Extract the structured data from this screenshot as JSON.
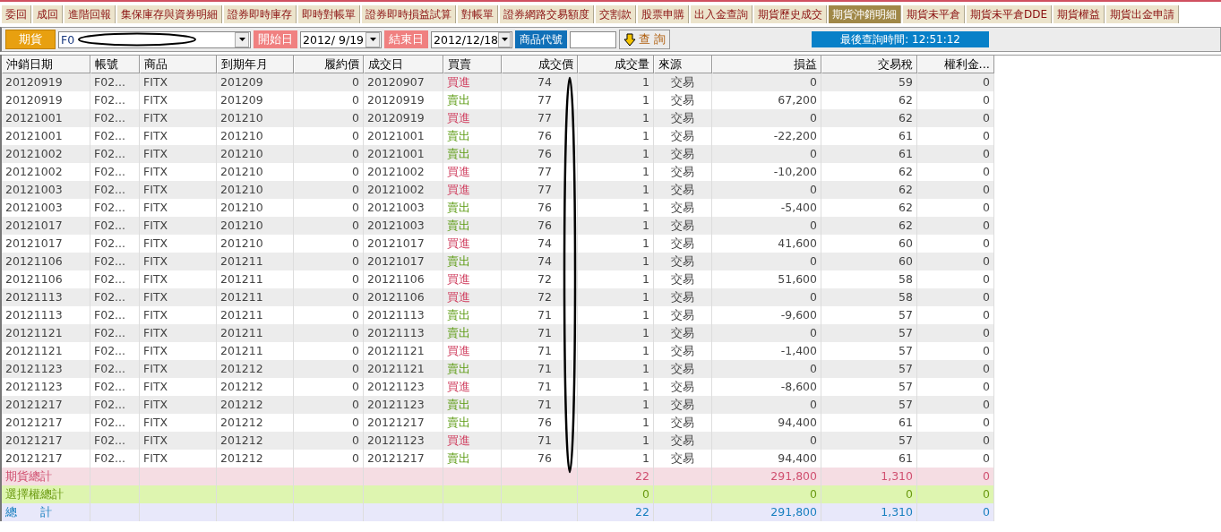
{
  "tabs": [
    {
      "label": "委回",
      "selected": false
    },
    {
      "label": "成回",
      "selected": false
    },
    {
      "label": "進階回報",
      "selected": false
    },
    {
      "label": "集保庫存與資券明細",
      "selected": false
    },
    {
      "label": "證券即時庫存",
      "selected": false
    },
    {
      "label": "即時對帳單",
      "selected": false
    },
    {
      "label": "證券即時損益試算",
      "selected": false
    },
    {
      "label": "對帳單",
      "selected": false
    },
    {
      "label": "證券網路交易額度",
      "selected": false
    },
    {
      "label": "交割款",
      "selected": false
    },
    {
      "label": "股票申購",
      "selected": false
    },
    {
      "label": "出入金查詢",
      "selected": false
    },
    {
      "label": "期貨歷史成交",
      "selected": false
    },
    {
      "label": "期貨沖銷明細",
      "selected": true
    },
    {
      "label": "期貨未平倉",
      "selected": false
    },
    {
      "label": "期貨未平倉DDE",
      "selected": false
    },
    {
      "label": "期貨權益",
      "selected": false
    },
    {
      "label": "期貨出金申請",
      "selected": false
    }
  ],
  "toolbar": {
    "market_label": "期貨",
    "account": "F0",
    "start_label": "開始日",
    "start_date": "2012/ 9/19",
    "end_label": "結束日",
    "end_date": "2012/12/18",
    "product_label": "商品代號",
    "query_button": "查 詢",
    "last_query": "最後查詢時間: 12:51:12"
  },
  "table": {
    "columns": [
      "沖銷日期",
      "帳號",
      "商品",
      "到期年月",
      "履約價",
      "成交日",
      "買賣",
      "成交價",
      "成交量",
      "來源",
      "損益",
      "交易稅",
      "權利金..."
    ],
    "rows": [
      {
        "kind": "buy",
        "cells": [
          "20120919",
          "F02...",
          "FITX",
          "201209",
          "0",
          "20120907",
          "買進",
          "74",
          "1",
          "交易",
          "0",
          "59",
          "0"
        ]
      },
      {
        "kind": "sell",
        "cells": [
          "20120919",
          "F02...",
          "FITX",
          "201209",
          "0",
          "20120919",
          "賣出",
          "77",
          "1",
          "交易",
          "67,200",
          "62",
          "0"
        ]
      },
      {
        "kind": "buy",
        "cells": [
          "20121001",
          "F02...",
          "FITX",
          "201210",
          "0",
          "20120919",
          "買進",
          "77",
          "1",
          "交易",
          "0",
          "62",
          "0"
        ]
      },
      {
        "kind": "sell",
        "cells": [
          "20121001",
          "F02...",
          "FITX",
          "201210",
          "0",
          "20121001",
          "賣出",
          "76",
          "1",
          "交易",
          "-22,200",
          "61",
          "0"
        ]
      },
      {
        "kind": "sell",
        "cells": [
          "20121002",
          "F02...",
          "FITX",
          "201210",
          "0",
          "20121001",
          "賣出",
          "76",
          "1",
          "交易",
          "0",
          "61",
          "0"
        ]
      },
      {
        "kind": "buy",
        "cells": [
          "20121002",
          "F02...",
          "FITX",
          "201210",
          "0",
          "20121002",
          "買進",
          "77",
          "1",
          "交易",
          "-10,200",
          "62",
          "0"
        ]
      },
      {
        "kind": "buy",
        "cells": [
          "20121003",
          "F02...",
          "FITX",
          "201210",
          "0",
          "20121002",
          "買進",
          "77",
          "1",
          "交易",
          "0",
          "62",
          "0"
        ]
      },
      {
        "kind": "sell",
        "cells": [
          "20121003",
          "F02...",
          "FITX",
          "201210",
          "0",
          "20121003",
          "賣出",
          "76",
          "1",
          "交易",
          "-5,400",
          "62",
          "0"
        ]
      },
      {
        "kind": "sell",
        "cells": [
          "20121017",
          "F02...",
          "FITX",
          "201210",
          "0",
          "20121003",
          "賣出",
          "76",
          "1",
          "交易",
          "0",
          "62",
          "0"
        ]
      },
      {
        "kind": "buy",
        "cells": [
          "20121017",
          "F02...",
          "FITX",
          "201210",
          "0",
          "20121017",
          "買進",
          "74",
          "1",
          "交易",
          "41,600",
          "60",
          "0"
        ]
      },
      {
        "kind": "sell",
        "cells": [
          "20121106",
          "F02...",
          "FITX",
          "201211",
          "0",
          "20121017",
          "賣出",
          "74",
          "1",
          "交易",
          "0",
          "60",
          "0"
        ]
      },
      {
        "kind": "buy",
        "cells": [
          "20121106",
          "F02...",
          "FITX",
          "201211",
          "0",
          "20121106",
          "買進",
          "72",
          "1",
          "交易",
          "51,600",
          "58",
          "0"
        ]
      },
      {
        "kind": "buy",
        "cells": [
          "20121113",
          "F02...",
          "FITX",
          "201211",
          "0",
          "20121106",
          "買進",
          "72",
          "1",
          "交易",
          "0",
          "58",
          "0"
        ]
      },
      {
        "kind": "sell",
        "cells": [
          "20121113",
          "F02...",
          "FITX",
          "201211",
          "0",
          "20121113",
          "賣出",
          "71",
          "1",
          "交易",
          "-9,600",
          "57",
          "0"
        ]
      },
      {
        "kind": "sell",
        "cells": [
          "20121121",
          "F02...",
          "FITX",
          "201211",
          "0",
          "20121113",
          "賣出",
          "71",
          "1",
          "交易",
          "0",
          "57",
          "0"
        ]
      },
      {
        "kind": "buy",
        "cells": [
          "20121121",
          "F02...",
          "FITX",
          "201211",
          "0",
          "20121121",
          "買進",
          "71",
          "1",
          "交易",
          "-1,400",
          "57",
          "0"
        ]
      },
      {
        "kind": "sell",
        "cells": [
          "20121123",
          "F02...",
          "FITX",
          "201212",
          "0",
          "20121121",
          "賣出",
          "71",
          "1",
          "交易",
          "0",
          "57",
          "0"
        ]
      },
      {
        "kind": "buy",
        "cells": [
          "20121123",
          "F02...",
          "FITX",
          "201212",
          "0",
          "20121123",
          "買進",
          "71",
          "1",
          "交易",
          "-8,600",
          "57",
          "0"
        ]
      },
      {
        "kind": "sell",
        "cells": [
          "20121217",
          "F02...",
          "FITX",
          "201212",
          "0",
          "20121123",
          "賣出",
          "71",
          "1",
          "交易",
          "0",
          "57",
          "0"
        ]
      },
      {
        "kind": "sell",
        "cells": [
          "20121217",
          "F02...",
          "FITX",
          "201212",
          "0",
          "20121217",
          "賣出",
          "76",
          "1",
          "交易",
          "94,400",
          "61",
          "0"
        ]
      },
      {
        "kind": "buy",
        "cells": [
          "20121217",
          "F02...",
          "FITX",
          "201212",
          "0",
          "20121123",
          "買進",
          "71",
          "1",
          "交易",
          "0",
          "57",
          "0"
        ]
      },
      {
        "kind": "sell",
        "cells": [
          "20121217",
          "F02...",
          "FITX",
          "201212",
          "0",
          "20121217",
          "賣出",
          "76",
          "1",
          "交易",
          "94,400",
          "61",
          "0"
        ]
      }
    ],
    "totals": [
      {
        "kind": "futures",
        "label": "期貨總計",
        "quantity": "22",
        "profit": "291,800",
        "tax": "1,310",
        "premium": "0"
      },
      {
        "kind": "options",
        "label": "選擇權總計",
        "quantity": "0",
        "profit": "0",
        "tax": "0",
        "premium": "0"
      },
      {
        "kind": "all",
        "label": "總　　計",
        "quantity": "22",
        "profit": "291,800",
        "tax": "1,310",
        "premium": "0"
      }
    ]
  }
}
